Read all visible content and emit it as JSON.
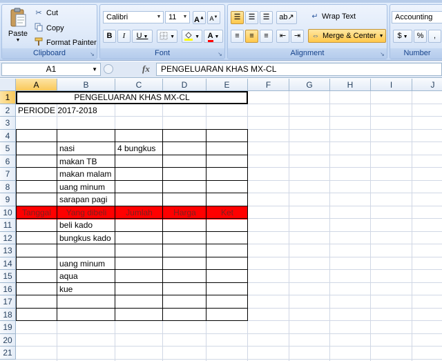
{
  "ribbon": {
    "clipboard": {
      "label": "Clipboard",
      "paste": "Paste",
      "cut": "Cut",
      "copy": "Copy",
      "format_painter": "Format Painter"
    },
    "font": {
      "label": "Font",
      "name": "Calibri",
      "size": "11",
      "bold": "B",
      "italic": "I",
      "underline": "U"
    },
    "alignment": {
      "label": "Alignment",
      "wrap_text": "Wrap Text",
      "merge_center": "Merge & Center"
    },
    "number": {
      "label": "Number",
      "format": "Accounting",
      "currency": "$",
      "percent": "%"
    },
    "colors": {
      "fill": "#ffff00",
      "font": "#ff0000"
    }
  },
  "formula_bar": {
    "name_box": "A1",
    "fx": "fx",
    "content": "PENGELUARAN KHAS MX-CL"
  },
  "sheet": {
    "columns": [
      "A",
      "B",
      "C",
      "D",
      "E",
      "F",
      "G",
      "H",
      "I",
      "J"
    ],
    "rows": [
      "1",
      "2",
      "3",
      "4",
      "5",
      "6",
      "7",
      "8",
      "9",
      "10",
      "11",
      "12",
      "13",
      "14",
      "15",
      "16",
      "17",
      "18",
      "19",
      "20",
      "21"
    ],
    "title": "PENGELUARAN KHAS MX-CL",
    "period": "PERIODE 2017-2018",
    "headers": [
      "Tanggal",
      "Yang dibeli",
      "Jumlah",
      "Harga",
      "Ket"
    ],
    "header_color": "#ff0000",
    "items": [
      {
        "row": 5,
        "b": "nasi",
        "c": "4 bungkus"
      },
      {
        "row": 6,
        "b": "makan TB",
        "c": ""
      },
      {
        "row": 7,
        "b": "makan malam",
        "c": ""
      },
      {
        "row": 8,
        "b": "uang minum",
        "c": ""
      },
      {
        "row": 9,
        "b": "sarapan pagi",
        "c": ""
      },
      {
        "row": 11,
        "b": "beli kado",
        "c": ""
      },
      {
        "row": 12,
        "b": "bungkus kado",
        "c": ""
      },
      {
        "row": 14,
        "b": "uang minum",
        "c": ""
      },
      {
        "row": 15,
        "b": "aqua",
        "c": ""
      },
      {
        "row": 16,
        "b": "kue",
        "c": ""
      }
    ]
  }
}
